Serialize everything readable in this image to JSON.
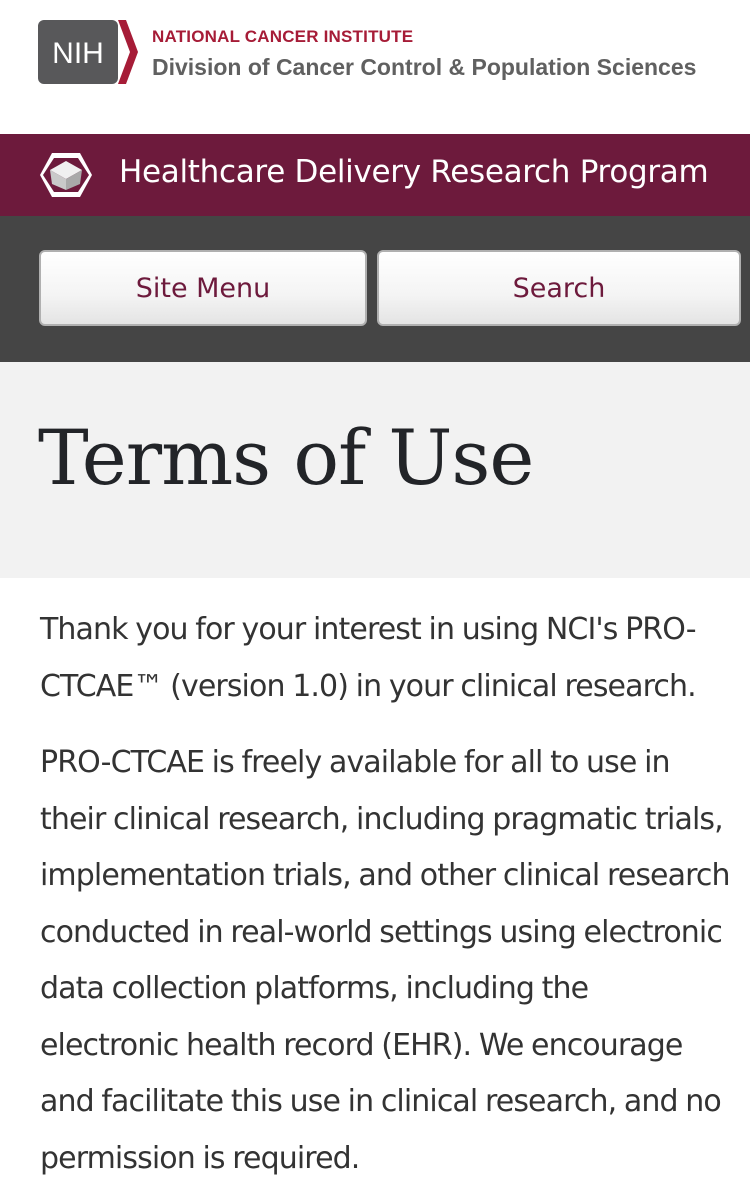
{
  "header": {
    "logo": {
      "text": "NIH",
      "box_color": "#58585a",
      "chevron_color": "#a61c37"
    },
    "org_line_1": "NATIONAL CANCER INSTITUTE",
    "org_line_2": "Division of Cancer Control & Population Sciences"
  },
  "banner": {
    "icon": "hexagon-cube-icon",
    "title": "Healthcare Delivery Research Program",
    "background": "#6d1a3c"
  },
  "nav": {
    "menu_label": "Site Menu",
    "search_label": "Search",
    "background": "#454545"
  },
  "page": {
    "title": "Terms of Use"
  },
  "content": {
    "paragraph_1": "Thank you for your interest in using NCI's PRO-CTCAE™ (version 1.0) in your clinical research.",
    "paragraph_2": "PRO-CTCAE is freely available for all to use in their clinical research, including pragmatic trials, implementation trials, and other clinical research conducted in real-world settings using electronic data collection platforms, including the electronic health record (EHR). We encourage and facilitate this use in clinical research, and no permission is required."
  }
}
